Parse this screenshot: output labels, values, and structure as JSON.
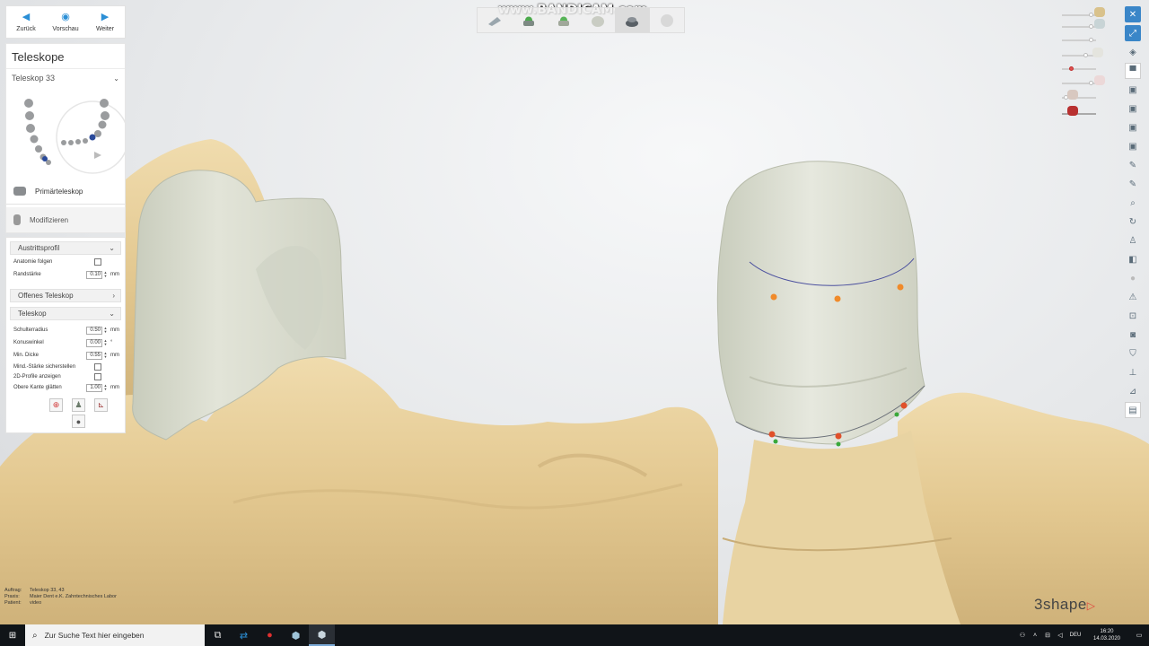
{
  "nav": {
    "back": "Zurück",
    "preview": "Vorschau",
    "next": "Weiter"
  },
  "panel": {
    "title": "Teleskope",
    "dropdown": "Teleskop 33",
    "step_primary": "Primärteleskop",
    "step_modify": "Modifizieren"
  },
  "settings": {
    "exit_profile": {
      "title": "Austrittsprofil",
      "follow_anatomy": "Anatomie folgen",
      "margin_thickness": "Randstärke",
      "margin_thickness_value": "0.10",
      "unit_mm": "mm"
    },
    "open_telescope": "Offenes Teleskop",
    "telescope": {
      "title": "Teleskop",
      "shoulder_radius": "Schulterradius",
      "shoulder_radius_value": "0.50",
      "cone_angle": "Konuswinkel",
      "cone_angle_value": "0.00",
      "degree": "°",
      "min_thickness": "Min. Dicke",
      "min_thickness_value": "0.55",
      "ensure_min_thickness": "Mind.-Stärke sicherstellen",
      "show_2d_profiles": "2D-Profile anzeigen",
      "smooth_top_edge": "Obere Kante glätten",
      "smooth_top_edge_value": "1.00",
      "unit_mm": "mm"
    }
  },
  "watermark": "www.BANDICAM.com",
  "info": {
    "order_label": "Auftrag:",
    "order_value": "Teleskop 33, 43",
    "practice_label": "Praxis:",
    "practice_value": "Maier Dent e.K. Zahntechnisches Labor",
    "patient_label": "Patient:",
    "patient_value": "video"
  },
  "logo": "3shape",
  "taskbar": {
    "search_placeholder": "Zur Suche Text hier eingeben",
    "language": "DEU",
    "time": "16:20",
    "date": "14.03.2020"
  },
  "colors": {
    "accent": "#2b8fd6",
    "model": "#e6cc98",
    "crown": "#d9dccd",
    "taskbar": "#101418"
  }
}
